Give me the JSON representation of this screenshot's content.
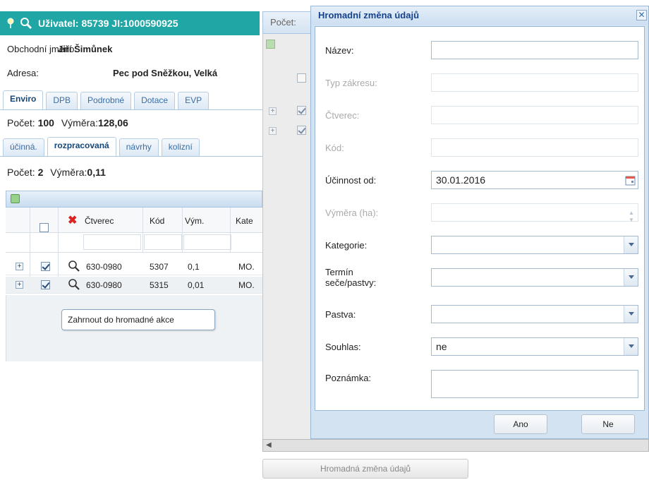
{
  "user_bar": {
    "title": "Uživatel: 85739 JI:1000590925"
  },
  "info": {
    "business_name_label": "Obchodní jméno:",
    "business_name_value": "Jiří Šimůnek",
    "address_label": "Adresa:",
    "address_value": "Pec pod Sněžkou, Velká"
  },
  "main_tabs": [
    {
      "label": "Enviro",
      "active": true
    },
    {
      "label": "DPB",
      "active": false
    },
    {
      "label": "Podrobné",
      "active": false
    },
    {
      "label": "Dotace",
      "active": false
    },
    {
      "label": "EVP",
      "active": false
    }
  ],
  "summary1": {
    "count_label": "Počet:",
    "count_value": "100",
    "area_label": "Výměra:",
    "area_value": "128,06"
  },
  "sub_tabs": [
    {
      "label": "účinná.",
      "active": false
    },
    {
      "label": "rozpracovaná",
      "active": true
    },
    {
      "label": "návrhy",
      "active": false
    },
    {
      "label": "kolizní",
      "active": false
    }
  ],
  "summary2": {
    "count_label": "Počet:",
    "count_value": "2",
    "area_label": "Výměra:",
    "area_value": "0,11"
  },
  "grid": {
    "columns": [
      "Čtverec",
      "Kód",
      "Vým.",
      "Kate"
    ],
    "rows": [
      {
        "ctverec": "630-0980",
        "kod": "5307",
        "vym": "0,1",
        "kat": "MO.",
        "checked": true
      },
      {
        "ctverec": "630-0980",
        "kod": "5315",
        "vym": "0,01",
        "kat": "MO.",
        "checked": true
      }
    ],
    "tooltip": "Zahrnout do hromadné akce"
  },
  "back_panel": {
    "header_label": "Počet:",
    "bulk_button_label": "Hromadná změna údajů"
  },
  "dialog": {
    "title": "Hromadní změna údajů",
    "fields": {
      "nazev": {
        "label": "Název:",
        "value": ""
      },
      "typ_zakresu": {
        "label": "Typ zákresu:",
        "value": ""
      },
      "ctverec": {
        "label": "Čtverec:",
        "value": ""
      },
      "kod": {
        "label": "Kód:",
        "value": ""
      },
      "ucinnost_od": {
        "label": "Účinnost od:",
        "value": "30.01.2016"
      },
      "vymera": {
        "label": "Výměra (ha):",
        "value": ""
      },
      "kategorie": {
        "label": "Kategorie:",
        "value": ""
      },
      "termin": {
        "label_line1": "Termín",
        "label_line2": "seče/pastvy:",
        "value": ""
      },
      "pastva": {
        "label": "Pastva:",
        "value": ""
      },
      "souhlas": {
        "label": "Souhlas:",
        "value": "ne"
      },
      "poznamka": {
        "label": "Poznámka:",
        "value": ""
      }
    },
    "buttons": {
      "yes": "Ano",
      "no": "Ne"
    }
  },
  "colors": {
    "user_bar_bg": "#1fa6a5",
    "dialog_title": "#15428b",
    "tab_link": "#3a6ea5"
  }
}
